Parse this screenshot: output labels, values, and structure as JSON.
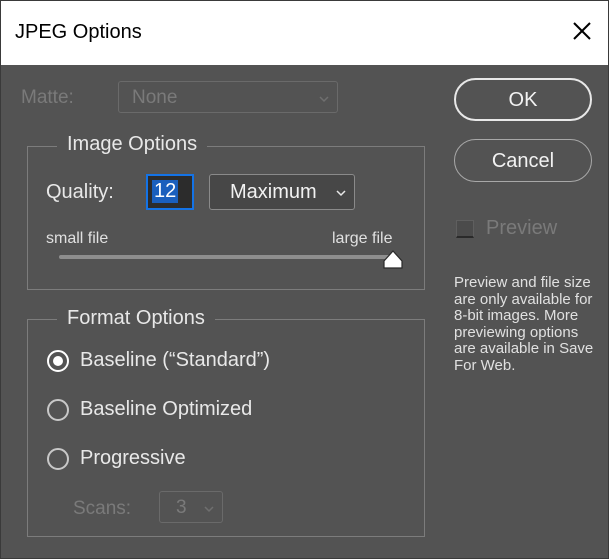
{
  "window": {
    "title": "JPEG Options"
  },
  "matte": {
    "label": "Matte:",
    "value": "None"
  },
  "image_options": {
    "title": "Image Options",
    "quality_label": "Quality:",
    "quality_value": "12",
    "quality_preset": "Maximum",
    "small_label": "small file",
    "large_label": "large file",
    "quality_level": 12,
    "quality_max": 12
  },
  "format_options": {
    "title": "Format Options",
    "options": [
      {
        "label": "Baseline (“Standard”)",
        "checked": true
      },
      {
        "label": "Baseline Optimized",
        "checked": false
      },
      {
        "label": "Progressive",
        "checked": false
      }
    ],
    "scans_label": "Scans:",
    "scans_value": "3"
  },
  "buttons": {
    "ok": "OK",
    "cancel": "Cancel"
  },
  "preview": {
    "label": "Preview",
    "checked": false,
    "info": "Preview and file size are only available for 8-bit images. More previewing options are available in Save For Web."
  },
  "icons": {
    "close": "close-icon",
    "chevron": "chevron-down-icon",
    "thumb": "slider-thumb-icon"
  }
}
